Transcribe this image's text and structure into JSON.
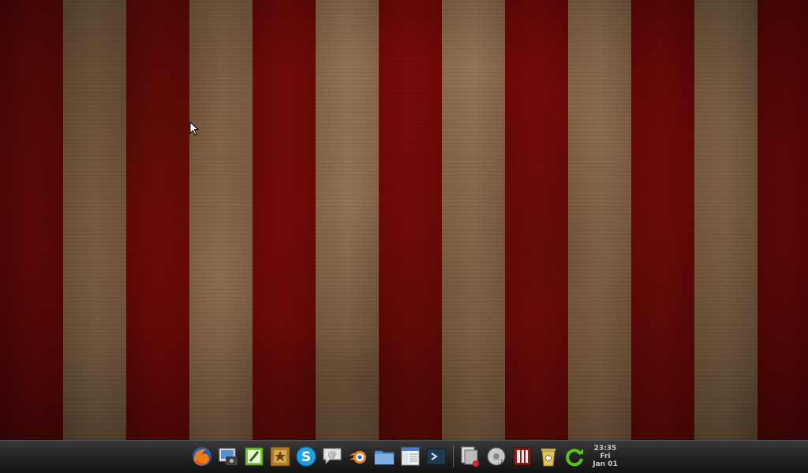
{
  "desktop": {
    "stripe_colors": [
      "#7a0a0a",
      "#8a6a4a"
    ]
  },
  "dock": {
    "icons": [
      {
        "name": "firefox-icon"
      },
      {
        "name": "screenshot-icon"
      },
      {
        "name": "text-editor-icon"
      },
      {
        "name": "sticker-icon"
      },
      {
        "name": "skype-icon"
      },
      {
        "name": "chat-icon"
      },
      {
        "name": "blender-icon"
      },
      {
        "name": "folder-icon"
      },
      {
        "name": "file-manager-icon"
      },
      {
        "name": "terminal-icon"
      },
      {
        "name": "recent-apps-icon"
      },
      {
        "name": "disc-icon"
      },
      {
        "name": "app-launcher-icon"
      },
      {
        "name": "trash-icon"
      },
      {
        "name": "refresh-icon"
      }
    ],
    "clock": {
      "time": "23:35",
      "day": "Fri",
      "date": "Jan 01"
    }
  }
}
